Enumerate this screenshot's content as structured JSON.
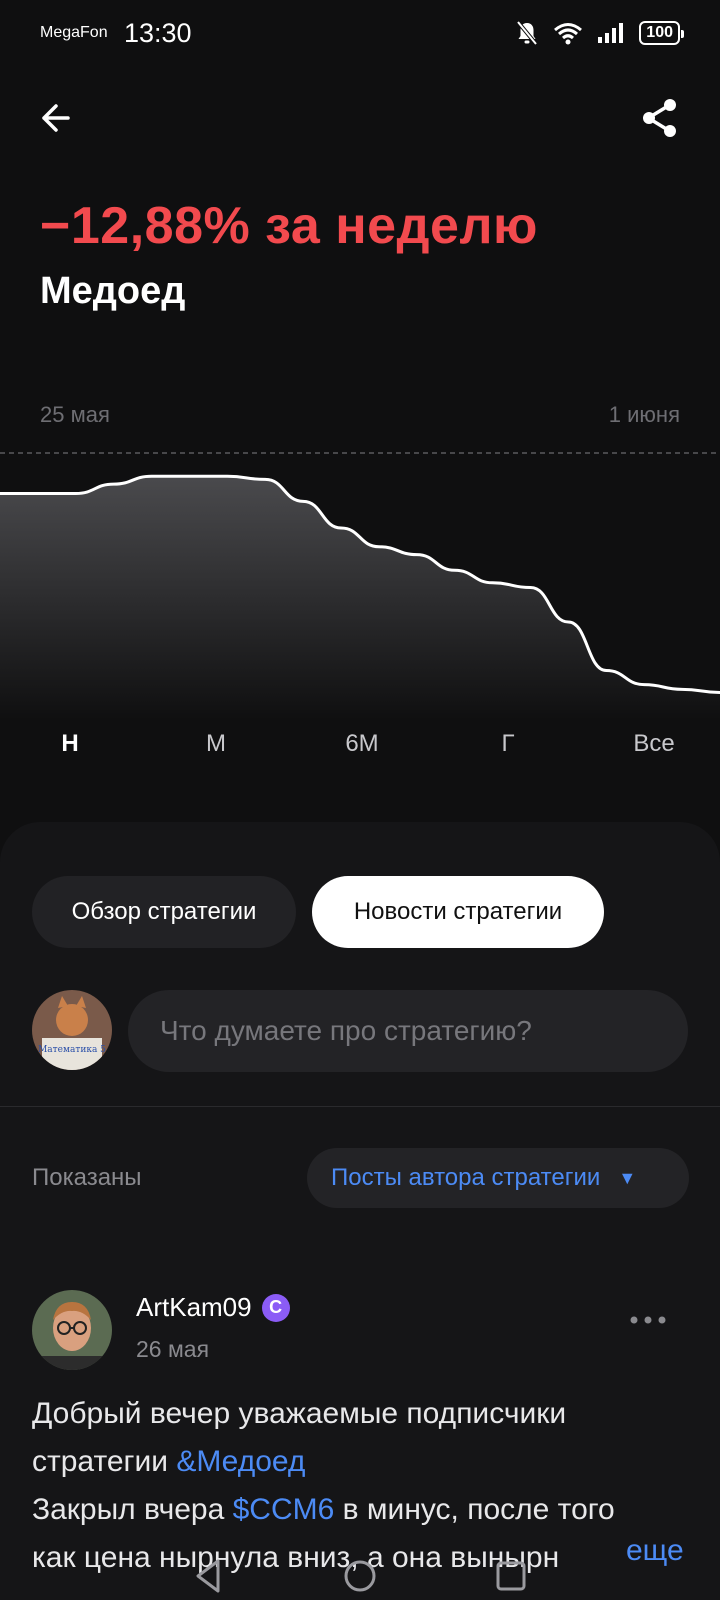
{
  "status_bar": {
    "carrier": "MegaFon",
    "time": "13:30",
    "battery": "100"
  },
  "header": {
    "performance": "−12,88% за неделю",
    "strategy_name": "Медоед"
  },
  "chart_data": {
    "type": "area",
    "x_start_label": "25 мая",
    "x_end_label": "1 июня",
    "series": [
      {
        "values": [
          100,
          100,
          100,
          100.6,
          101.1,
          101.1,
          101.1,
          100.9,
          99.5,
          97.8,
          96.6,
          96.1,
          95.1,
          94.3,
          94.0,
          91.8,
          88.7,
          87.8,
          87.5,
          87.3
        ]
      }
    ]
  },
  "periods": [
    "Н",
    "М",
    "6М",
    "Г",
    "Все"
  ],
  "active_period": "Н",
  "tabs": [
    {
      "label": "Обзор стратегии",
      "active": false
    },
    {
      "label": "Новости стратегии",
      "active": true
    }
  ],
  "comment_box": {
    "placeholder": "Что думаете про стратегию?",
    "avatar_text": "Математика 5"
  },
  "filter": {
    "shown_label": "Показаны",
    "value": "Посты автора стратегии"
  },
  "post": {
    "author": "ArtKam09",
    "badge": "C",
    "date": "26 мая",
    "line1": "Добрый вечер уважаемые подписчики",
    "line2_prefix": "стратегии ",
    "line2_link": "&Медоед",
    "line3_prefix": "Закрыл вчера ",
    "line3_link": "$CCM6",
    "line3_suffix": " в минус, после того",
    "line4": "как цена нырнула вниз, а она вынырн",
    "more_label": "еще"
  },
  "colors": {
    "negative": "#f24a4e",
    "link": "#4c8bf5",
    "badge": "#8b5cf6"
  }
}
